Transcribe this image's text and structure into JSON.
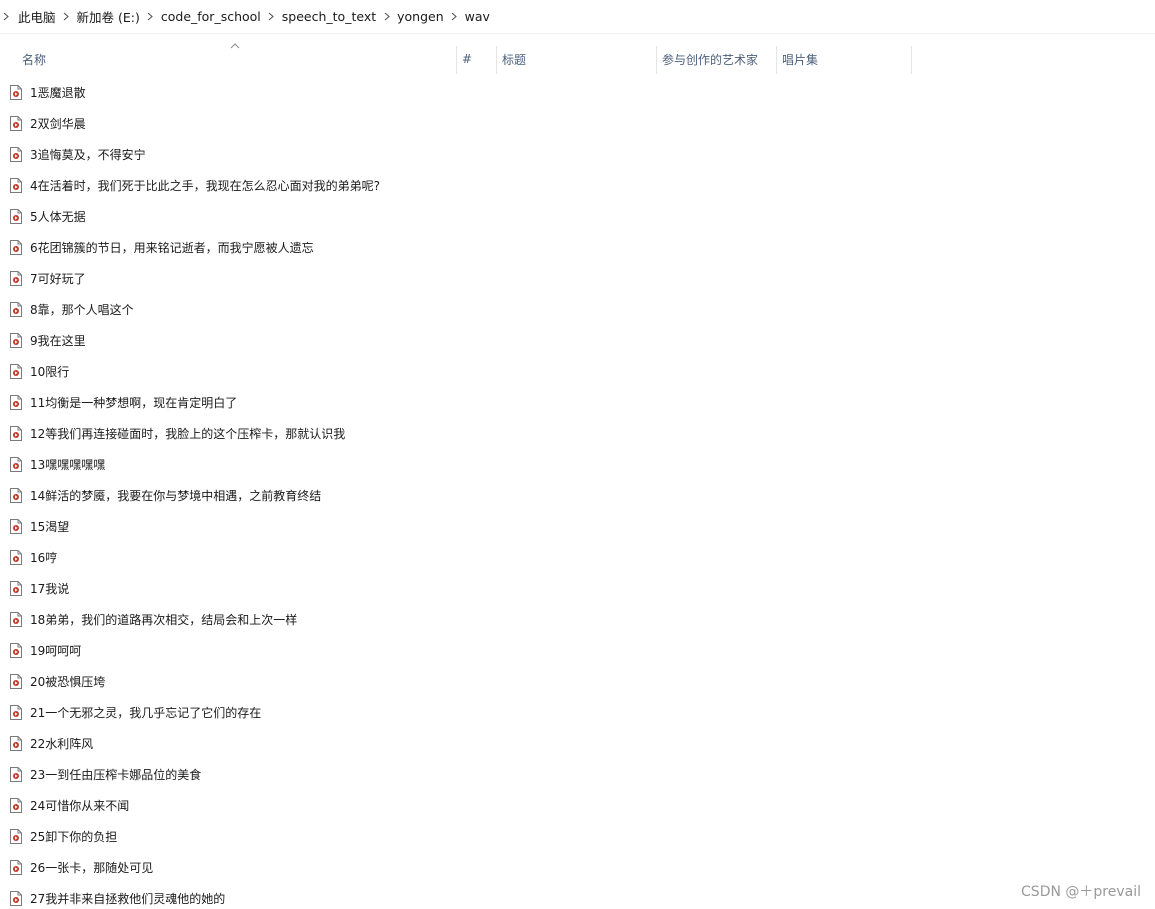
{
  "breadcrumb": [
    "此电脑",
    "新加卷 (E:)",
    "code_for_school",
    "speech_to_text",
    "yongen",
    "wav"
  ],
  "columns": {
    "name": "名称",
    "number": "#",
    "title": "标题",
    "artists": "参与创作的艺术家",
    "album": "唱片集"
  },
  "files": [
    "1恶魔退散",
    "2双剑华晨",
    "3追悔莫及，不得安宁",
    "4在活着时，我们死于比此之手，我现在怎么忍心面对我的弟弟呢?",
    "5人体无据",
    "6花团锦簇的节日，用来铭记逝者，而我宁愿被人遗忘",
    "7可好玩了",
    "8靠，那个人唱这个",
    "9我在这里",
    "10限行",
    "11均衡是一种梦想啊，现在肯定明白了",
    "12等我们再连接碰面时，我脸上的这个压榨卡，那就认识我",
    "13嘿嘿嘿嘿嘿",
    "14鲜活的梦魇，我要在你与梦境中相遇，之前教育终结",
    "15渴望",
    "16哼",
    "17我说",
    "18弟弟，我们的道路再次相交，结局会和上次一样",
    "19呵呵呵",
    "20被恐惧压垮",
    "21一个无邪之灵，我几乎忘记了它们的存在",
    "22水利阵风",
    "23一到任由压榨卡娜品位的美食",
    "24可惜你从来不闻",
    "25卸下你的负担",
    "26一张卡，那随处可见",
    "27我并非来自拯救他们灵魂他的她的"
  ],
  "watermark": "CSDN @＋prevail",
  "icons": {
    "file": "audio-file-icon",
    "chevron": "chevron-right-icon",
    "sort": "sort-ascending-icon"
  },
  "colors": {
    "header_text": "#4c607a",
    "icon_accent": "#c0392b"
  }
}
